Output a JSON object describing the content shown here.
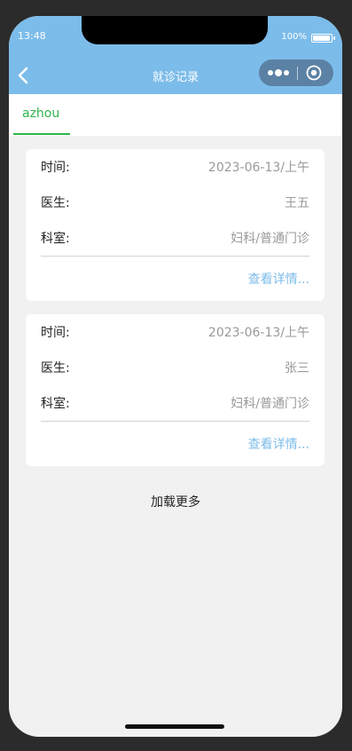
{
  "status_bar": {
    "time": "13:48",
    "battery": "100%"
  },
  "nav": {
    "title": "就诊记录"
  },
  "tabs": [
    {
      "label": "azhou",
      "active": true
    }
  ],
  "records": [
    {
      "time_label": "时间:",
      "time_value": "2023-06-13/上午",
      "doctor_label": "医生:",
      "doctor_value": "王五",
      "dept_label": "科室:",
      "dept_value": "妇科/普通门诊",
      "detail_link": "查看详情..."
    },
    {
      "time_label": "时间:",
      "time_value": "2023-06-13/上午",
      "doctor_label": "医生:",
      "doctor_value": "张三",
      "dept_label": "科室:",
      "dept_value": "妇科/普通门诊",
      "detail_link": "查看详情..."
    }
  ],
  "load_more": "加载更多",
  "colors": {
    "nav_bg": "#7cbcea",
    "tab_active": "#2fb44b",
    "link": "#7cbcea",
    "page_bg": "#f1f1f1"
  }
}
